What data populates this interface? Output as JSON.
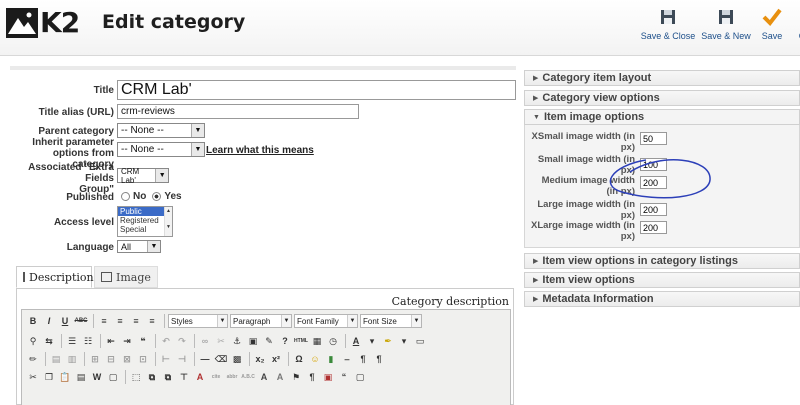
{
  "header": {
    "logo_text": "K2",
    "title": "Edit category",
    "buttons": [
      {
        "label": "Save & Close",
        "icon": "floppy-disk-icon"
      },
      {
        "label": "Save & New",
        "icon": "floppy-disk-icon"
      },
      {
        "label": "Save",
        "icon": "checkmark-icon"
      },
      {
        "label": "C",
        "icon": "cancel-icon"
      }
    ]
  },
  "form": {
    "title_label": "Title",
    "title_value": "CRM Lab'",
    "alias_label": "Title alias (URL)",
    "alias_value": "crm-reviews",
    "parent_label": "Parent category",
    "parent_value": "-- None --",
    "inherit_label_1": "Inherit parameter",
    "inherit_label_2": "options from category",
    "inherit_value": "-- None --",
    "inherit_link": "Learn what this means",
    "extra_label_1": "Associated \"Extra Fields",
    "extra_label_2": "Group\"",
    "extra_value": "CRM Lab'",
    "published_label": "Published",
    "published_no": "No",
    "published_yes": "Yes",
    "access_label": "Access level",
    "access_options": [
      "Public",
      "Registered",
      "Special"
    ],
    "access_selected": "Public",
    "language_label": "Language",
    "language_value": "All"
  },
  "tabs": {
    "description": "Description",
    "image": "Image"
  },
  "editor": {
    "label": "Category description",
    "toolbar_row1": {
      "styles": "Styles",
      "format": "Paragraph",
      "font_family": "Font Family",
      "font_size": "Font Size"
    },
    "bold": "B",
    "italic": "I",
    "underline": "U",
    "strike": "ABC"
  },
  "panels": {
    "category_item_layout": "Category item layout",
    "category_view_options": "Category view options",
    "item_image_options": "Item image options",
    "item_view_options_listings": "Item view options in category listings",
    "item_view_options": "Item view options",
    "metadata_information": "Metadata Information"
  },
  "image_options": {
    "xsmall_label": "XSmall image width (in px)",
    "xsmall_value": "50",
    "small_label": "Small image width (in px)",
    "small_value": "100",
    "medium_label": "Medium image width (in px)",
    "medium_value": "200",
    "large_label": "Large image width (in px)",
    "large_value": "200",
    "xlarge_label": "XLarge image width (in px)",
    "xlarge_value": "200"
  },
  "colors": {
    "link_blue": "#1d4f8a",
    "check_orange": "#e8900f",
    "annotation_blue": "#2c3fb8"
  }
}
